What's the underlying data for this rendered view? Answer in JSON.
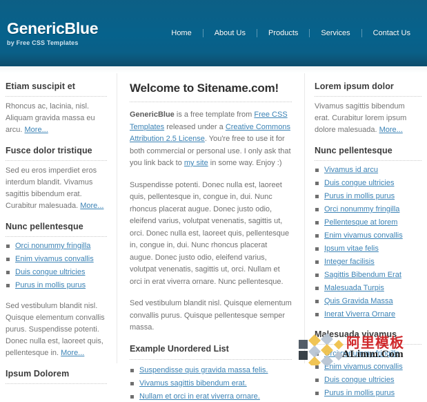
{
  "header": {
    "logo_title": "GenericBlue",
    "logo_tagline": "by Free CSS Templates",
    "menu": [
      {
        "label": "Home"
      },
      {
        "label": "About Us"
      },
      {
        "label": "Products"
      },
      {
        "label": "Services"
      },
      {
        "label": "Contact Us"
      }
    ]
  },
  "sidebar_left": {
    "sections": [
      {
        "title": "Etiam suscipit et",
        "body_before": "Rhoncus ac, lacinia, nisl. Aliquam gravida massa eu arcu. ",
        "more_label": "More..."
      },
      {
        "title": "Fusce dolor tristique",
        "body_before": "Sed eu eros imperdiet eros interdum blandit. Vivamus sagittis bibendum erat. Curabitur malesuada. ",
        "more_label": "More..."
      }
    ],
    "list_section": {
      "title": "Nunc pellentesque",
      "items": [
        "Orci nonummy fringilla",
        "Enim vivamus convallis",
        "Duis congue ultricies",
        "Purus in mollis purus"
      ],
      "body_before": "Sed vestibulum blandit nisl. Quisque elementum convallis purus. Suspendisse potenti. Donec nulla est, laoreet quis, pellentesque in. ",
      "more_label": "More..."
    },
    "last_title": "Ipsum Dolorem"
  },
  "content": {
    "title": "Welcome to Sitename.com!",
    "intro": {
      "p1_a": "GenericBlue",
      "p1_b": " is a free template from ",
      "link1": "Free CSS Templates",
      "p1_c": " released under a ",
      "link2": "Creative Commons Attribution 2.5 License",
      "p1_d": ". You're free to use it for both commercial or personal use. I only ask that you link back to ",
      "link3": "my site",
      "p1_e": " in some way. Enjoy :)"
    },
    "paragraph2": "Suspendisse potenti. Donec nulla est, laoreet quis, pellentesque in, congue in, dui. Nunc rhoncus placerat augue. Donec justo odio, eleifend varius, volutpat venenatis, sagittis ut, orci. Donec nulla est, laoreet quis, pellentesque in, congue in, dui. Nunc rhoncus placerat augue. Donec justo odio, eleifend varius, volutpat venenatis, sagittis ut, orci. Nullam et orci in erat viverra ornare. Nunc pellentesque.",
    "paragraph3": "Sed vestibulum blandit nisl. Quisque elementum convallis purus. Quisque pellentesque semper massa.",
    "list_title": "Example Unordered List",
    "list_items": [
      "Suspendisse quis gravida massa felis.",
      "Vivamus sagittis bibendum erat.",
      "Nullam et orci in erat viverra ornare."
    ]
  },
  "sidebar_right": {
    "section1": {
      "title": "Lorem ipsum dolor",
      "body_before": "Vivamus sagittis bibendum erat. Curabitur lorem ipsum dolore malesuada. ",
      "more_label": "More..."
    },
    "section2": {
      "title": "Nunc pellentesque",
      "items": [
        "Vivamus id arcu",
        "Duis congue ultricies",
        "Purus in mollis purus",
        "Orci nonummy fringilla",
        "Pellentesque at lorem",
        "Enim vivamus convallis",
        "Ipsum vitae felis",
        "Integer facilisis",
        "Sagittis Bibendum Erat",
        "Malesuada Turpis",
        "Quis Gravida Massa",
        "Inerat Viverra Ornare"
      ]
    },
    "section3": {
      "title": "Malesuada vivamus",
      "items": [
        "Orci nonummy fringilla",
        "Enim vivamus convallis",
        "Duis congue ultricies",
        "Purus in mollis purus"
      ]
    }
  },
  "watermark": {
    "text": "阿里模板",
    "sub": "ALimm.Com"
  }
}
